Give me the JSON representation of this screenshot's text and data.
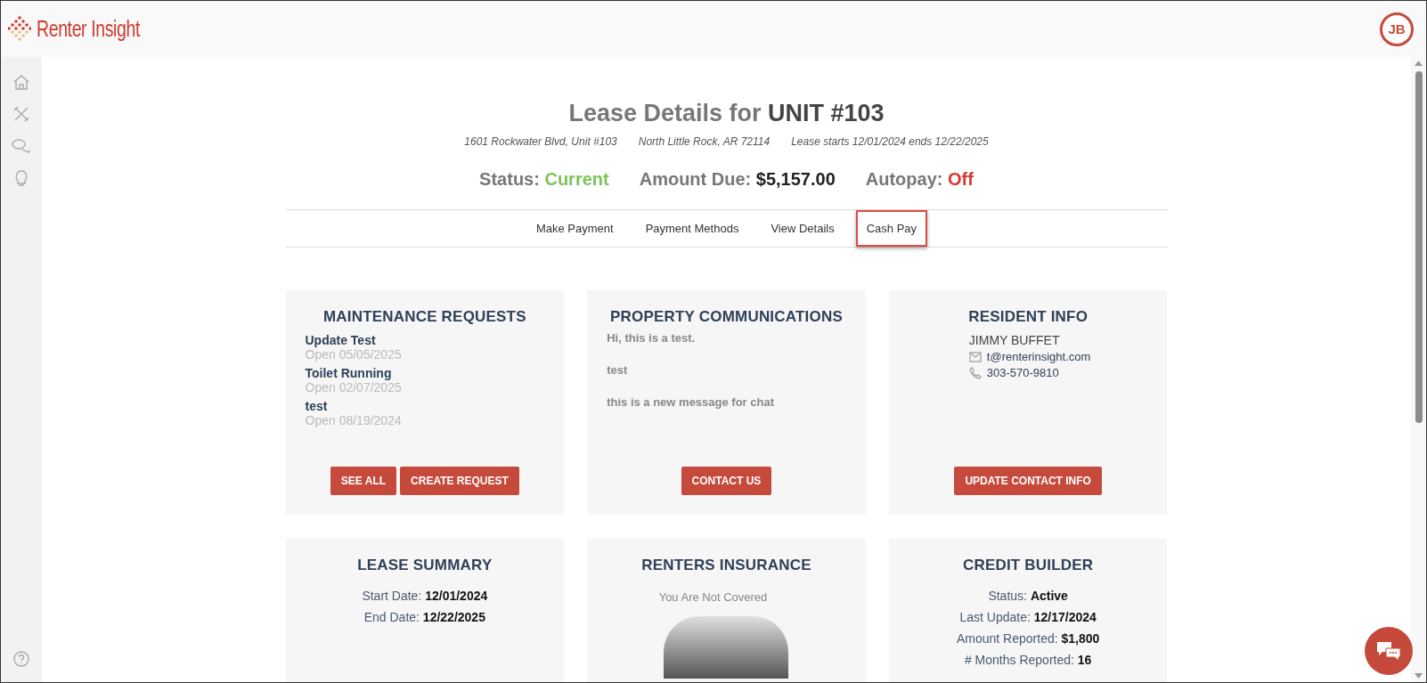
{
  "header": {
    "logo": "Renter Insight",
    "avatar": "JB"
  },
  "page": {
    "title_prefix": "Lease Details for",
    "title_unit": "UNIT #103",
    "address": "1601 Rockwater Blvd, Unit #103",
    "city": "North Little Rock, AR 72114",
    "lease_dates": "Lease starts 12/01/2024 ends 12/22/2025"
  },
  "summary": [
    {
      "label": "Status:",
      "value": "Current",
      "color": "#7cc35b"
    },
    {
      "label": "Amount Due:",
      "value": "$5,157.00",
      "color": "#222222"
    },
    {
      "label": "Autopay:",
      "value": "Off",
      "color": "#d63a2f"
    }
  ],
  "tabs": [
    {
      "label": "Make Payment",
      "highlighted": false
    },
    {
      "label": "Payment Methods",
      "highlighted": false
    },
    {
      "label": "View Details",
      "highlighted": false
    },
    {
      "label": "Cash Pay",
      "highlighted": true
    }
  ],
  "cards": [
    {
      "kind": "requests",
      "title": "MAINTENANCE REQUESTS",
      "items": [
        {
          "title": "Update Test",
          "status": "Open 05/05/2025"
        },
        {
          "title": "Toilet Running",
          "status": "Open 02/07/2025"
        },
        {
          "title": "test",
          "status": "Open 08/19/2024"
        }
      ],
      "buttons": [
        "SEE ALL",
        "CREATE REQUEST"
      ]
    },
    {
      "kind": "messages",
      "title": "PROPERTY COMMUNICATIONS",
      "messages": [
        "Hi, this is a test.",
        "test",
        "this is a new message for chat"
      ],
      "buttons": [
        "CONTACT US"
      ]
    },
    {
      "kind": "contact",
      "title": "RESIDENT INFO",
      "name": "JIMMY BUFFET",
      "email": "t@renterinsight.com",
      "phone": "303-570-9810",
      "buttons": [
        "UPDATE CONTACT INFO"
      ]
    },
    {
      "kind": "fields",
      "title": "LEASE SUMMARY",
      "fields": [
        {
          "label": "Start Date:",
          "value": "12/01/2024"
        },
        {
          "label": "End Date:",
          "value": "12/22/2025"
        }
      ]
    },
    {
      "kind": "insurance",
      "title": "RENTERS INSURANCE",
      "note": "You Are Not Covered"
    },
    {
      "kind": "fields",
      "title": "CREDIT BUILDER",
      "fields": [
        {
          "label": "Status:",
          "value": "Active"
        },
        {
          "label": "Last Update:",
          "value": "12/17/2024"
        },
        {
          "label": "Amount Reported:",
          "value": "$1,800"
        },
        {
          "label": "# Months Reported:",
          "value": "16"
        }
      ]
    }
  ]
}
